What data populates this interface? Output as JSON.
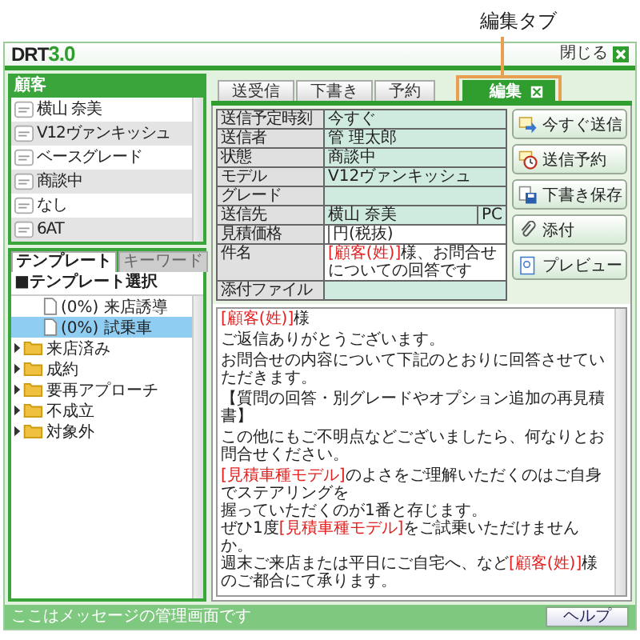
{
  "annotation": {
    "label": "編集タブ"
  },
  "window": {
    "logo": "DRT",
    "version": "3.0",
    "close_label": "閉じる"
  },
  "customer_panel": {
    "title": "顧客",
    "rows": [
      {
        "value": "横山 奈美"
      },
      {
        "value": "V12ヴァンキッシュ"
      },
      {
        "value": "ベースグレード"
      },
      {
        "value": "商談中"
      },
      {
        "value": "なし"
      },
      {
        "value": "6AT"
      }
    ]
  },
  "template_tabs": [
    {
      "label": "テンプレート",
      "selected": true
    },
    {
      "label": "キーワード",
      "selected": false
    }
  ],
  "template_heading": "■テンプレート選択",
  "template_tree": [
    {
      "kind": "file",
      "label": "(0%) 来店誘導",
      "selected": false
    },
    {
      "kind": "file",
      "label": "(0%) 試乗車",
      "selected": true
    },
    {
      "kind": "folder",
      "label": "来店済み",
      "selected": false
    },
    {
      "kind": "folder",
      "label": "成約",
      "selected": false
    },
    {
      "kind": "folder",
      "label": "要再アプローチ",
      "selected": false
    },
    {
      "kind": "folder",
      "label": "不成立",
      "selected": false
    },
    {
      "kind": "folder",
      "label": "対象外",
      "selected": false
    }
  ],
  "main_tabs": [
    {
      "label": "送受信",
      "selected": false,
      "closable": false
    },
    {
      "label": "下書き",
      "selected": false,
      "closable": false
    },
    {
      "label": "予約",
      "selected": false,
      "closable": false
    },
    {
      "label": "編集",
      "selected": true,
      "closable": true
    }
  ],
  "form": [
    {
      "label": "送信予定時刻",
      "value": [
        {
          "text": "今すぐ",
          "highlight": false
        }
      ],
      "editable": false
    },
    {
      "label": "送信者",
      "value": [
        {
          "text": "管 理太郎",
          "highlight": false
        }
      ],
      "editable": false
    },
    {
      "label": "状態",
      "value": [
        {
          "text": "商談中",
          "highlight": false
        }
      ],
      "editable": false
    },
    {
      "label": "モデル",
      "value": [
        {
          "text": "V12ヴァンキッシュ",
          "highlight": false
        }
      ],
      "editable": false
    },
    {
      "label": "グレード",
      "editable": false
    },
    {
      "label": "送信先",
      "value": [
        {
          "text": "横山 奈美",
          "highlight": false
        }
      ],
      "suffix": "PC",
      "editable": false
    },
    {
      "label": "見積価格",
      "suffix": "円(税抜)",
      "editable": true
    },
    {
      "label": "件名",
      "value": [
        {
          "text": "[顧客(姓)]",
          "highlight": true
        },
        {
          "text": "様、お問合せについての回答です",
          "highlight": false
        }
      ],
      "editable": true
    },
    {
      "label": "添付ファイル",
      "editable": false
    }
  ],
  "actions": [
    {
      "label": "今すぐ送信"
    },
    {
      "label": "送信予約"
    },
    {
      "label": "下書き保存"
    },
    {
      "label": "添付"
    },
    {
      "label": "プレビュー"
    }
  ],
  "body": [
    [
      [
        {
          "text": "[顧客(姓)]",
          "highlight": true
        },
        {
          "text": "様",
          "highlight": false
        }
      ]
    ],
    [
      [
        {
          "text": "ご返信ありがとうございます。",
          "highlight": false
        }
      ]
    ],
    [
      [
        {
          "text": "お問合せの内容について下記のとおりに回答させていただきます。",
          "highlight": false
        }
      ]
    ],
    [
      [
        {
          "text": "【質問の回答・別グレードやオプション追加の再見積書】",
          "highlight": false
        }
      ]
    ],
    [
      [
        {
          "text": "この他にもご不明点などございましたら、何なりとお問合せください。",
          "highlight": false
        }
      ]
    ],
    [
      [
        {
          "text": "[見積車種モデル]",
          "highlight": true
        },
        {
          "text": "のよさをご理解いただくのはご自身でステアリングを",
          "highlight": false
        }
      ],
      [
        {
          "text": "握っていただくのが1番と存じます。",
          "highlight": false
        }
      ],
      [
        {
          "text": "ぜひ1度",
          "highlight": false
        },
        {
          "text": "[見積車種モデル]",
          "highlight": true
        },
        {
          "text": "をご試乗いただけませんか。",
          "highlight": false
        }
      ],
      [
        {
          "text": "週末ご来店または平日にご自宅へ、など",
          "highlight": false
        },
        {
          "text": "[顧客(姓)]",
          "highlight": true
        },
        {
          "text": "様のご都合にて承ります。",
          "highlight": false
        }
      ]
    ]
  ],
  "status_bar": {
    "message": "ここはメッセージの管理画面です",
    "help": "ヘルプ"
  }
}
